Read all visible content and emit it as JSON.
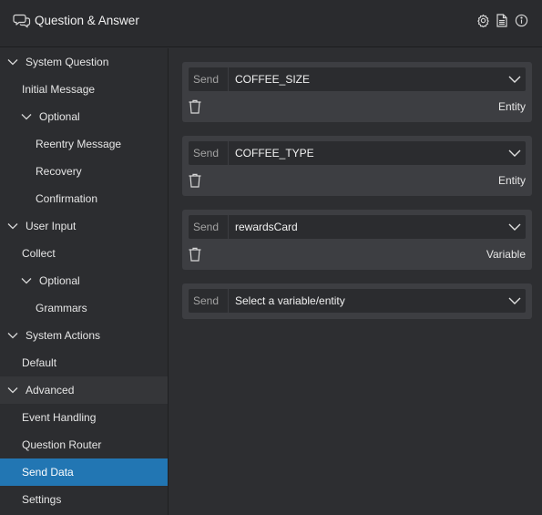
{
  "header": {
    "title": "Question & Answer",
    "icons": [
      "chat-bubbles-icon",
      "gear-icon",
      "document-icon",
      "info-icon"
    ]
  },
  "sidebar": {
    "items": [
      {
        "label": "System Question",
        "kind": "section",
        "expanded": true
      },
      {
        "label": "Initial Message"
      },
      {
        "label": "Optional",
        "kind": "group",
        "expanded": true
      },
      {
        "label": "Reentry Message"
      },
      {
        "label": "Recovery"
      },
      {
        "label": "Confirmation"
      },
      {
        "label": "User Input",
        "kind": "section",
        "expanded": true
      },
      {
        "label": "Collect"
      },
      {
        "label": "Optional",
        "kind": "group",
        "expanded": true
      },
      {
        "label": "Grammars"
      },
      {
        "label": "System Actions",
        "kind": "section",
        "expanded": true
      },
      {
        "label": "Default"
      },
      {
        "label": "Advanced",
        "kind": "section",
        "expanded": true
      },
      {
        "label": "Event Handling"
      },
      {
        "label": "Question Router"
      },
      {
        "label": "Send Data",
        "selected": true
      },
      {
        "label": "Settings"
      }
    ]
  },
  "main": {
    "cards": [
      {
        "send_label": "Send",
        "value": "COFFEE_SIZE",
        "type": "Entity"
      },
      {
        "send_label": "Send",
        "value": "COFFEE_TYPE",
        "type": "Entity"
      },
      {
        "send_label": "Send",
        "value": "rewardsCard",
        "type": "Variable"
      },
      {
        "send_label": "Send",
        "value": "Select a variable/entity"
      }
    ]
  },
  "colors": {
    "accent": "#2276b3",
    "background": "#2d2e31",
    "card": "#3d3e42"
  }
}
